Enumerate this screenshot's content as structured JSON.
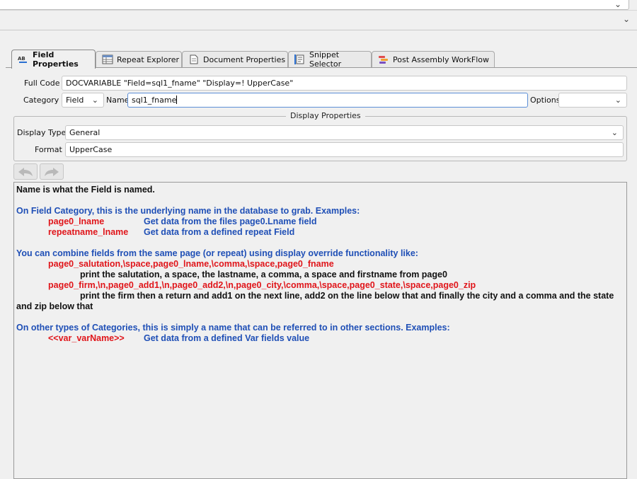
{
  "top": {
    "chevron_icon": "chevron-down-icon"
  },
  "tabs": [
    {
      "label": "Field Properties",
      "icon": "field-ab-icon",
      "active": true
    },
    {
      "label": "Repeat Explorer",
      "icon": "table-grid-icon"
    },
    {
      "label": "Document Properties",
      "icon": "document-icon"
    },
    {
      "label": "Snippet Selector",
      "icon": "snippet-icon"
    },
    {
      "label": "Post Assembly WorkFlow",
      "icon": "workflow-icon"
    }
  ],
  "form": {
    "full_code_label": "Full Code",
    "full_code_value": "DOCVARIABLE \"Field=sql1_fname\" \"Display=! UpperCase\"",
    "category_label": "Category",
    "category_value": "Field",
    "name_label": "Name",
    "name_value": "sql1_fname",
    "options_label": "Options",
    "options_value": ""
  },
  "display": {
    "group_title": "Display Properties",
    "type_label": "Display Type",
    "type_value": "General",
    "format_label": "Format",
    "format_value": "UpperCase"
  },
  "help": {
    "line1": "Name is what the Field is named.",
    "line2": "On Field Category, this is the underlying name in the database to grab. Examples:",
    "ex1_key": "page0_lname",
    "ex1_desc": "Get data from the files page0.Lname field",
    "ex2_key": "repeatname_lname",
    "ex2_desc": "Get data from a defined repeat Field",
    "line3": "You can combine fields from the same page (or repeat) using display override functionality like:",
    "combo1": "page0_salutation,\\space,page0_lname,\\comma,\\space,page0_fname",
    "combo1_desc": "print the salutation, a space, the lastname, a comma, a space and firstname from page0",
    "combo2": "page0_firm,\\n,page0_add1,\\n,page0_add2,\\n,page0_city,\\comma,\\space,page0_state,\\space,page0_zip",
    "combo2_desc_a": "print the firm then a return and add1 on the next line, add2 on the line below that and finally the city and a comma and the state",
    "combo2_desc_b": "and zip below that",
    "line4": "On other types of Categories, this is simply a name that can be referred to in other sections.  Examples:",
    "ex3_key": "<<var_varName>>",
    "ex3_desc": "Get data from a defined Var fields value"
  }
}
